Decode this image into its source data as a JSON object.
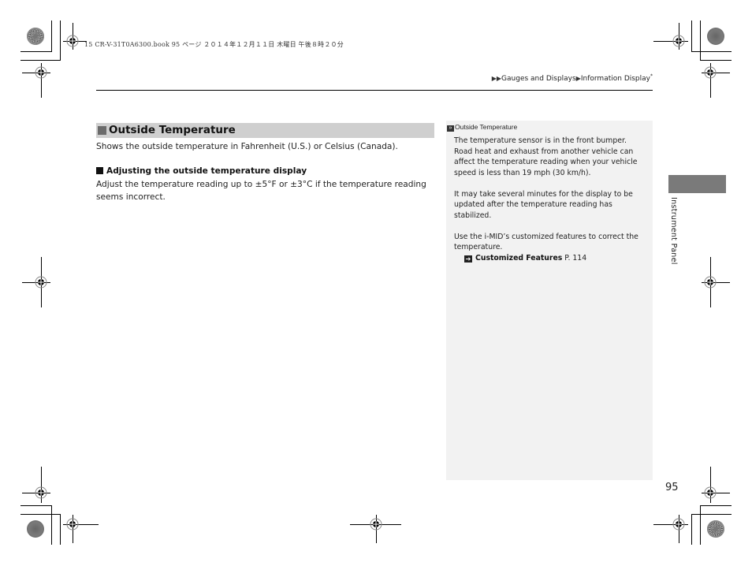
{
  "print_info": "15 CR-V-31T0A6300.book  95 ページ  ２０１４年１２月１１日  木曜日  午後８時２０分",
  "breadcrumb": {
    "items": [
      "Gauges and Displays",
      "Information Display"
    ],
    "separator_icon": "triangle-right-icon",
    "asterisk": "*"
  },
  "section": {
    "title": "Outside Temperature",
    "intro": "Shows the outside temperature in Fahrenheit (U.S.) or Celsius (Canada).",
    "subheading": "Adjusting the outside temperature display",
    "body": "Adjust the temperature reading up to ±5°F or ±3°C if the temperature reading seems incorrect."
  },
  "note": {
    "heading_icon": "double-chevron-icon",
    "heading": "Outside Temperature",
    "paragraphs": [
      "The temperature sensor is in the front bumper. Road heat and exhaust from another vehicle can affect the temperature reading when your vehicle speed is less than 19 mph (30 km/h).",
      "It may take several minutes for the display to be updated after the temperature reading has stabilized.",
      "Use the i-MID’s customized features to correct the temperature."
    ],
    "link": {
      "icon": "arrow-right-icon",
      "label": "Customized Features",
      "page": "P. 114"
    }
  },
  "side_tab": {
    "label": "Instrument Panel"
  },
  "page_number": "95",
  "colors": {
    "section_bar": "#cfcfcf",
    "note_bg": "#f2f2f2",
    "side_tab": "#7a7a7a"
  }
}
